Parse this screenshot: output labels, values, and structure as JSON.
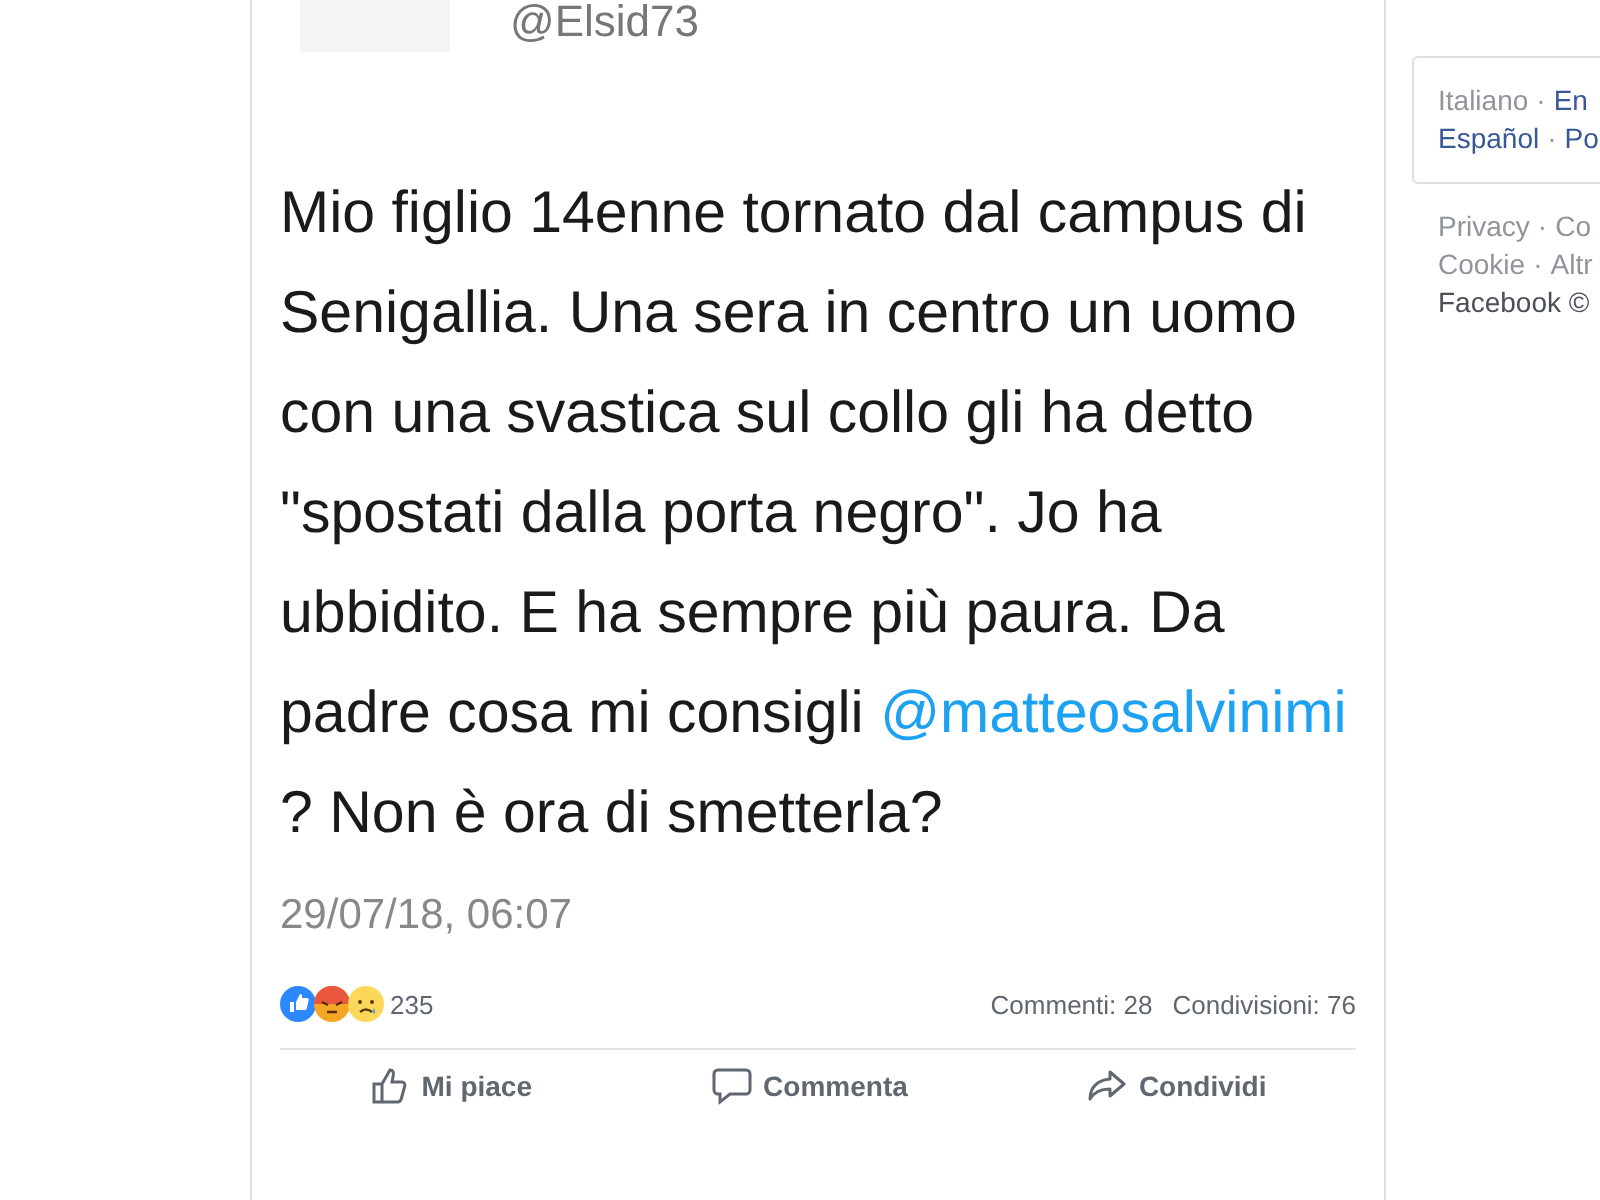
{
  "tweet": {
    "handle": "@Elsid73",
    "text_before": "Mio figlio 14enne tornato dal campus di Senigallia. Una sera in centro un uomo con una svastica sul collo gli ha detto \"spostati dalla porta negro\". Jo ha ubbidito. E ha sempre più paura. Da padre cosa mi consigli ",
    "mention": "@matteosalvinimi",
    "text_after": " ? Non è ora di smetterla?",
    "date": "29/07/18, 06:07"
  },
  "post": {
    "reactions": [
      {
        "kind": "like"
      },
      {
        "kind": "angry"
      },
      {
        "kind": "sad"
      }
    ],
    "reaction_count": "235",
    "comments": "Commenti: 28",
    "shares": "Condivisioni: 76",
    "actions": [
      {
        "kind": "like",
        "label": "Mi piace"
      },
      {
        "kind": "comment",
        "label": "Commenta"
      },
      {
        "kind": "share",
        "label": "Condividi"
      }
    ]
  },
  "sidebar": {
    "separator": "·",
    "languages": [
      [
        "Italiano",
        "En"
      ],
      [
        "Español",
        "Po"
      ]
    ],
    "footer_links": [
      [
        "Privacy",
        "Co"
      ],
      [
        "Cookie",
        "Altr"
      ]
    ],
    "copyright": "Facebook ©"
  }
}
